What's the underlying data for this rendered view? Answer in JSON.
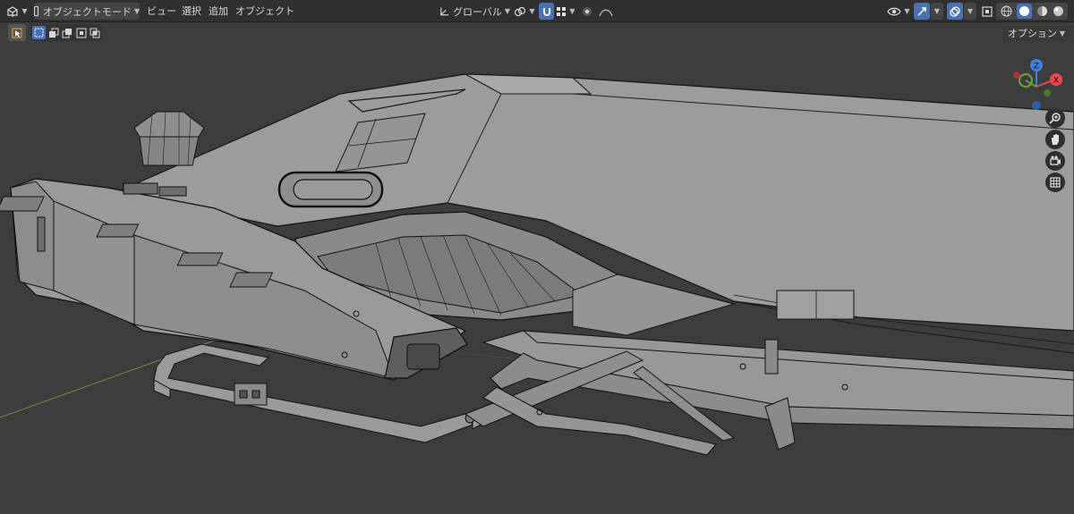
{
  "header": {
    "editor_type_icon": "3d-viewport-icon",
    "mode_label": "オブジェクトモード",
    "menus": [
      "ビュー",
      "選択",
      "追加",
      "オブジェクト"
    ],
    "transform_orientation": "グローバル",
    "pivot_icon": "pivot-point-icon",
    "snap_icon": "snap-magnet-icon",
    "snap_target_icon": "snap-increment-icon",
    "proportional_icon": "proportional-edit-icon",
    "falloff_icon": "falloff-curve-icon",
    "visibility_icon": "eye-icon",
    "gizmo_icon": "gizmo-arrow-icon",
    "overlay_icon": "overlays-icon",
    "xray_icon": "xray-icon",
    "shading_modes": [
      "wireframe",
      "solid",
      "material",
      "rendered"
    ],
    "active_shading": "solid"
  },
  "toolbar": {
    "select_icon": "select-box-icon",
    "select_modes": [
      "set",
      "extend",
      "subtract",
      "invert",
      "intersect"
    ],
    "active_select_mode": "set",
    "options_label": "オプション"
  },
  "gizmo": {
    "axes": [
      "X",
      "Y",
      "Z"
    ],
    "colors": {
      "x": "#f0444e",
      "y": "#6ba33a",
      "z": "#3c82e0"
    }
  },
  "nav_buttons": [
    "zoom-icon",
    "hand-pan-icon",
    "camera-icon",
    "grid-ortho-icon"
  ],
  "colors": {
    "background": "#3d3d3d",
    "header": "#303030",
    "active_button": "#4772b3",
    "mesh_surface": "#9d9d9d",
    "mesh_wire": "#111111"
  }
}
